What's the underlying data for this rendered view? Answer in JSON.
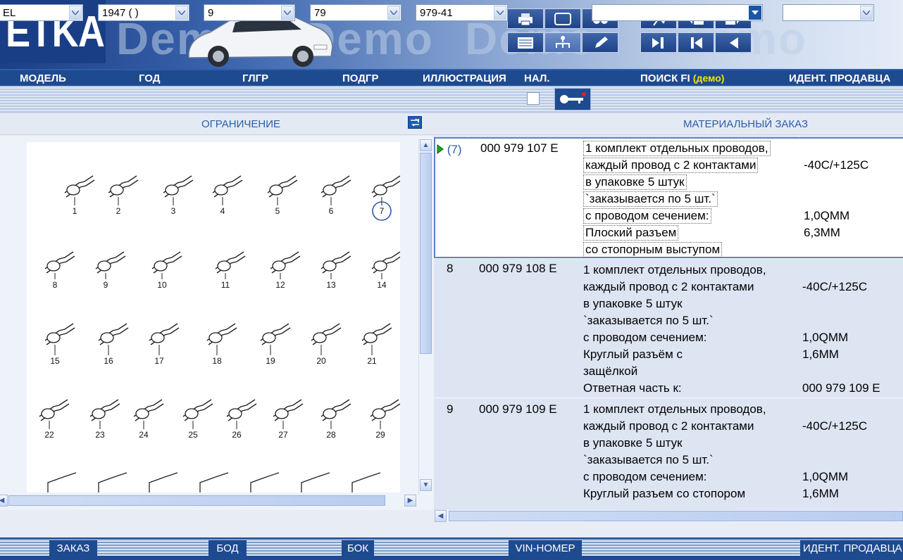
{
  "app": {
    "logo": "ETKA",
    "watermark": "Demo"
  },
  "labels": {
    "model": "МОДЕЛЬ",
    "year": "ГОД",
    "mg": "ГЛГР",
    "sg": "ПОДГР",
    "illustration": "ИЛЛЮСТРАЦИЯ",
    "avail": "НАЛ.",
    "search_fi": "ПОИСК FI",
    "search_demo": "(демо)",
    "dealer_id": "ИДЕНТ. ПРОДАВЦА"
  },
  "selectors": {
    "model": "EL",
    "year": "1947 ( )",
    "mg": "9",
    "sg": "79",
    "illustration": "979-41",
    "search_fi": "",
    "dealer_id": ""
  },
  "sections": {
    "left": "ОГРАНИЧЕНИЕ",
    "right": "МАТЕРИАЛЬНЫЙ ЗАКАЗ"
  },
  "parts": [
    {
      "pos": "(7)",
      "number": "000 979 107 E",
      "desc": [
        "1 комплект отдельных проводов,",
        "каждый провод с 2 контактами",
        "в упаковке 5 штук",
        "`заказывается по 5 шт.`",
        "с проводом сечением:",
        "Плоский разъем",
        "со стопорным выступом"
      ],
      "remark": [
        "",
        "-40C/+125C",
        "",
        "",
        "1,0QMM",
        "6,3MM",
        ""
      ]
    },
    {
      "pos": "8",
      "number": "000 979 108 E",
      "desc": [
        "1 комплект отдельных проводов,",
        "каждый провод с 2 контактами",
        "в упаковке 5 штук",
        "`заказывается по 5 шт.`",
        "с проводом сечением:",
        "Круглый разъём с",
        "защёлкой",
        "Ответная часть к:"
      ],
      "remark": [
        "",
        "-40C/+125C",
        "",
        "",
        "1,0QMM",
        "1,6MM",
        "",
        "000 979 109 E"
      ]
    },
    {
      "pos": "9",
      "number": "000 979 109 E",
      "desc": [
        "1 комплект отдельных проводов,",
        "каждый провод с 2 контактами",
        "в упаковке 5 штук",
        "`заказывается по 5 шт.`",
        "с проводом сечением:",
        "Круглый разъем со стопором"
      ],
      "remark": [
        "",
        "-40C/+125C",
        "",
        "",
        "1,0QMM",
        "1,6MM"
      ]
    }
  ],
  "illustration_labels": [
    "1",
    "2",
    "3",
    "4",
    "5",
    "6",
    "7",
    "8",
    "9",
    "10",
    "11",
    "12",
    "13",
    "14",
    "15",
    "16",
    "17",
    "18",
    "19",
    "20",
    "21",
    "22",
    "23",
    "24",
    "25",
    "26",
    "27",
    "28",
    "29"
  ],
  "footer": {
    "order": "ЗАКАЗ",
    "bod": "БОД",
    "bok": "БОК",
    "vin": "VIN-НОМЕР",
    "dealer": "ИДЕНТ. ПРОДАВЦА"
  },
  "colors": {
    "brand_dark": "#1e4a90",
    "link_blue": "#2d5ca8",
    "demo_yellow": "#f2e600"
  }
}
